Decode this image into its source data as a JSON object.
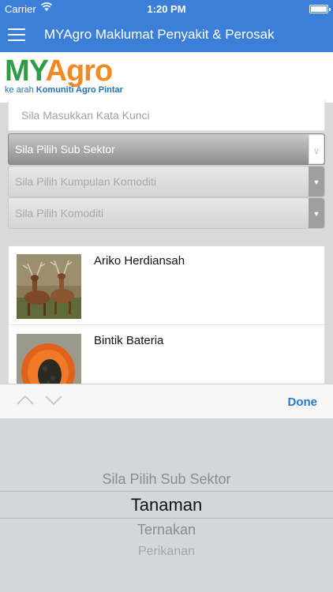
{
  "status": {
    "carrier": "Carrier",
    "time": "1:20 PM",
    "battery_level": 1.0
  },
  "nav": {
    "title": "MYAgro Maklumat Penyakit & Perosak"
  },
  "logo": {
    "my": "MY",
    "agro": "Agro",
    "tagline_prefix": "ke arah ",
    "tagline_bold": "Komuniti Agro Pintar"
  },
  "search": {
    "placeholder": "Sila Masukkan Kata Kunci",
    "value": ""
  },
  "filters": {
    "sub_sektor": "Sila Pilih Sub Sektor",
    "kumpulan_komoditi": "Sila Pilih Kumpulan Komoditi",
    "komoditi": "Sila Pilih Komoditi"
  },
  "items": [
    {
      "name": "Ariko Herdiansah",
      "image": "deer-photo"
    },
    {
      "name": "Bintik Bateria",
      "image": "papaya-photo"
    }
  ],
  "toolbar": {
    "done_label": "Done"
  },
  "picker": {
    "options": [
      "Sila Pilih Sub Sektor",
      "Tanaman",
      "Ternakan",
      "Perikanan"
    ],
    "selected": "Tanaman"
  }
}
